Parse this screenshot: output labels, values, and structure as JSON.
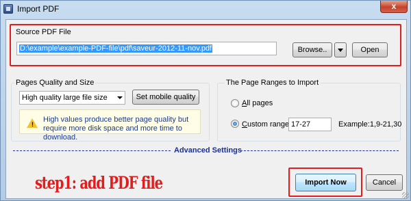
{
  "window": {
    "title": "Import PDF",
    "close_glyph": "x"
  },
  "source": {
    "group_label": "Source PDF File",
    "path_value": "D:\\example\\example-PDF-file\\pdf\\saveur-2012-11-nov.pdf",
    "browse_label": "Browse..",
    "open_label": "Open"
  },
  "quality": {
    "group_label": "Pages Quality and Size",
    "selected_option": "High quality large file size",
    "mobile_button_label": "Set mobile quality",
    "warning_text": "High values produce better page quality but require more disk space and more time to download."
  },
  "ranges": {
    "group_label": "The Page Ranges to Import",
    "all_pages_label": "All pages",
    "custom_range_label": "Custom range:",
    "custom_range_value": "17-27",
    "example_text": "Example:1,9-21,30",
    "selected": "custom"
  },
  "advanced": {
    "label": "Advanced Settings"
  },
  "footer": {
    "import_label": "Import Now",
    "cancel_label": "Cancel",
    "annotation": "step1: add PDF file"
  },
  "colors": {
    "annotation_red": "#e31d1d",
    "link_blue": "#1a2f94",
    "selection_blue": "#3399ff"
  }
}
